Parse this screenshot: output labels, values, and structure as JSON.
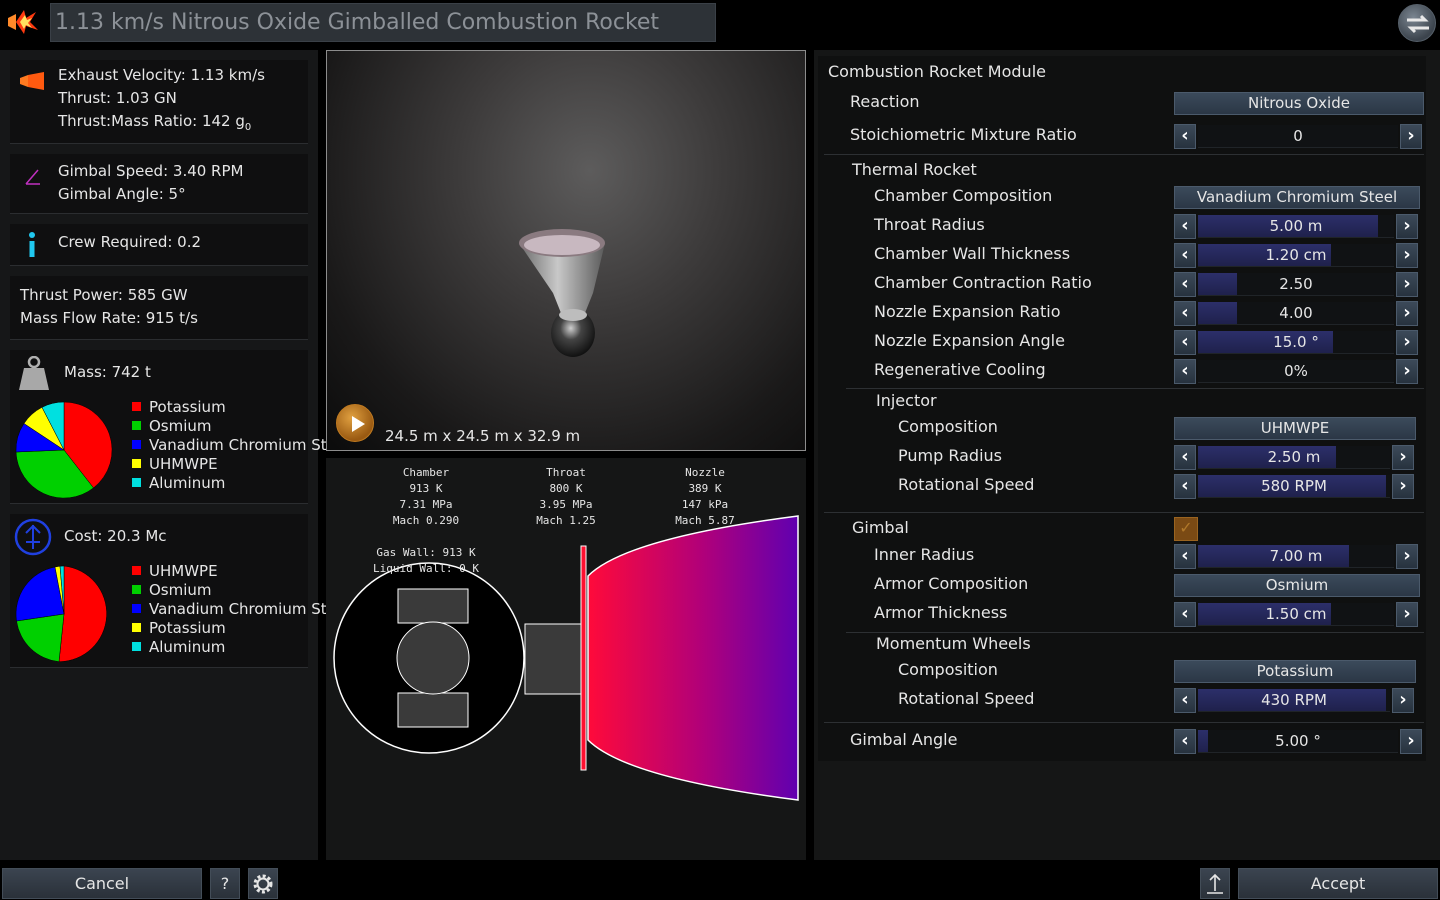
{
  "title": "1.13 km/s Nitrous Oxide Gimballed Combustion Rocket",
  "left": {
    "exhaust_velocity": "Exhaust Velocity: 1.13 km/s",
    "thrust": "Thrust: 1.03 GN",
    "thrust_mass_ratio": "Thrust:Mass Ratio: 142 g",
    "thrust_mass_sub": "0",
    "gimbal_speed": "Gimbal Speed: 3.40 RPM",
    "gimbal_angle": "Gimbal Angle: 5°",
    "crew_required": "Crew Required: 0.2",
    "thrust_power": "Thrust Power: 585 GW",
    "mass_flow": "Mass Flow Rate: 915 t/s",
    "mass": "Mass: 742 t",
    "mass_legend": [
      {
        "label": "Potassium",
        "color": "#ff0000"
      },
      {
        "label": "Osmium",
        "color": "#00d000"
      },
      {
        "label": "Vanadium Chromium St",
        "color": "#0000ff"
      },
      {
        "label": "UHMWPE",
        "color": "#ffff00"
      },
      {
        "label": "Aluminum",
        "color": "#00e0e0"
      }
    ],
    "cost": "Cost: 20.3 Mc",
    "cost_legend": [
      {
        "label": "UHMWPE",
        "color": "#ff0000"
      },
      {
        "label": "Osmium",
        "color": "#00d000"
      },
      {
        "label": "Vanadium Chromium St",
        "color": "#0000ff"
      },
      {
        "label": "Potassium",
        "color": "#ffff00"
      },
      {
        "label": "Aluminum",
        "color": "#00e0e0"
      }
    ]
  },
  "viewport": {
    "dimensions": "24.5 m x 24.5 m x 32.9 m"
  },
  "diagram": {
    "chamber": [
      "Chamber",
      "913 K",
      "7.31 MPa",
      "Mach 0.290"
    ],
    "throat": [
      "Throat",
      "800 K",
      "3.95 MPa",
      "Mach 1.25"
    ],
    "nozzle": [
      "Nozzle",
      "389 K",
      "147 kPa",
      "Mach 5.87"
    ],
    "gas_wall": "Gas Wall: 913 K",
    "liquid_wall": "Liquid Wall: 0 K"
  },
  "right": {
    "module_title": "Combustion Rocket Module",
    "reaction_label": "Reaction",
    "reaction_value": "Nitrous Oxide",
    "stoich_label": "Stoichiometric Mixture Ratio",
    "stoich_value": "0",
    "thermal_title": "Thermal Rocket",
    "chamber_comp_label": "Chamber Composition",
    "chamber_comp_value": "Vanadium Chromium Steel",
    "throat_radius_label": "Throat Radius",
    "throat_radius_value": "5.00 m",
    "wall_thickness_label": "Chamber Wall Thickness",
    "wall_thickness_value": "1.20 cm",
    "contraction_label": "Chamber Contraction Ratio",
    "contraction_value": "2.50",
    "expansion_ratio_label": "Nozzle Expansion Ratio",
    "expansion_ratio_value": "4.00",
    "expansion_angle_label": "Nozzle Expansion Angle",
    "expansion_angle_value": "15.0 °",
    "regen_label": "Regenerative Cooling",
    "regen_value": "0%",
    "injector_title": "Injector",
    "inj_comp_label": "Composition",
    "inj_comp_value": "UHMWPE",
    "pump_radius_label": "Pump Radius",
    "pump_radius_value": "2.50 m",
    "inj_speed_label": "Rotational Speed",
    "inj_speed_value": "580 RPM",
    "gimbal_title": "Gimbal",
    "inner_radius_label": "Inner Radius",
    "inner_radius_value": "7.00 m",
    "armor_comp_label": "Armor Composition",
    "armor_comp_value": "Osmium",
    "armor_thick_label": "Armor Thickness",
    "armor_thick_value": "1.50 cm",
    "momentum_title": "Momentum Wheels",
    "mw_comp_label": "Composition",
    "mw_comp_value": "Potassium",
    "mw_speed_label": "Rotational Speed",
    "mw_speed_value": "430 RPM",
    "gimbal_angle_label": "Gimbal Angle",
    "gimbal_angle_value": "5.00 °"
  },
  "bottom": {
    "cancel": "Cancel",
    "help": "?",
    "accept": "Accept"
  }
}
